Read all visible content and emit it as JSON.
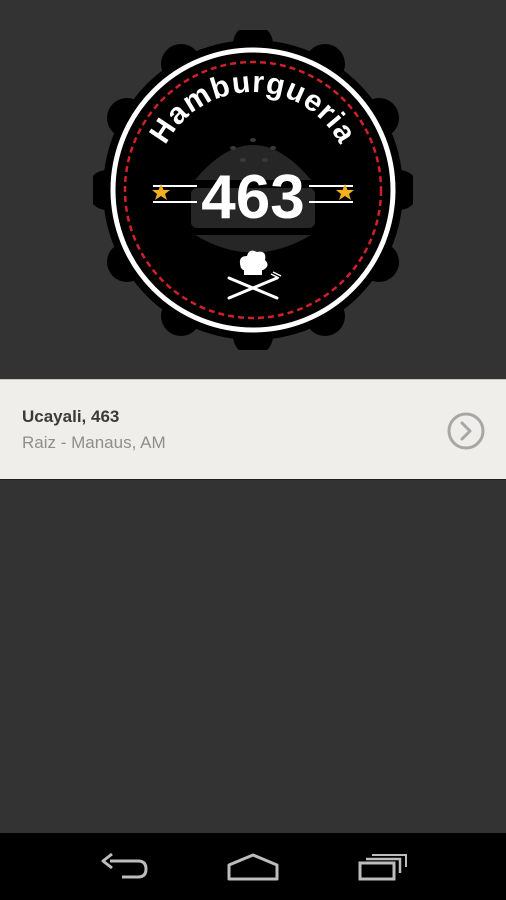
{
  "logo": {
    "brand_name": "Hamburgueria",
    "number": "463",
    "icon": "chef-hat-fork-knife-icon"
  },
  "location": {
    "title": "Ucayali, 463",
    "subtitle": "Raiz - Manaus, AM",
    "action_icon": "chevron-right-circle-icon"
  },
  "nav": {
    "back_icon": "back-icon",
    "home_icon": "home-icon",
    "recents_icon": "recent-apps-icon"
  },
  "colors": {
    "background": "#333333",
    "logo_black": "#000000",
    "dash_red": "#d0202a",
    "star_yellow": "#f2b01e",
    "row_bg": "#f0eeea"
  }
}
